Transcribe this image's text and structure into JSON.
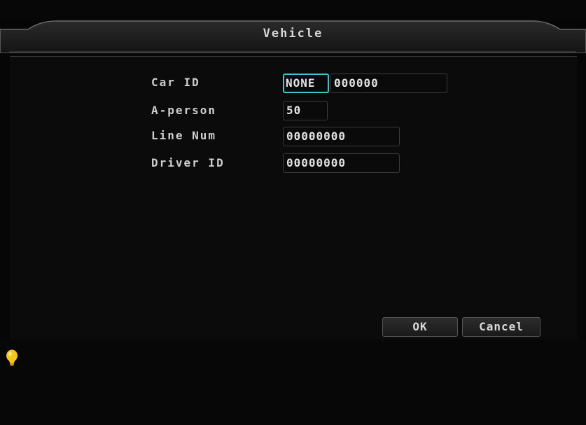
{
  "window": {
    "title": "Vehicle"
  },
  "form": {
    "car_id": {
      "label": "Car ID",
      "prefix_value": "NONE",
      "value": "000000"
    },
    "a_person": {
      "label": "A-person",
      "value": "50"
    },
    "line_num": {
      "label": "Line Num",
      "value": "00000000"
    },
    "driver_id": {
      "label": "Driver ID",
      "value": "00000000"
    }
  },
  "buttons": {
    "ok_label": "OK",
    "cancel_label": "Cancel"
  },
  "hint": {
    "icon": "lightbulb-icon",
    "icon_color": "#f5c518"
  },
  "colors": {
    "selection_border": "#3cc6c9",
    "text": "#d8d8d8",
    "background": "#0b0b0b"
  }
}
